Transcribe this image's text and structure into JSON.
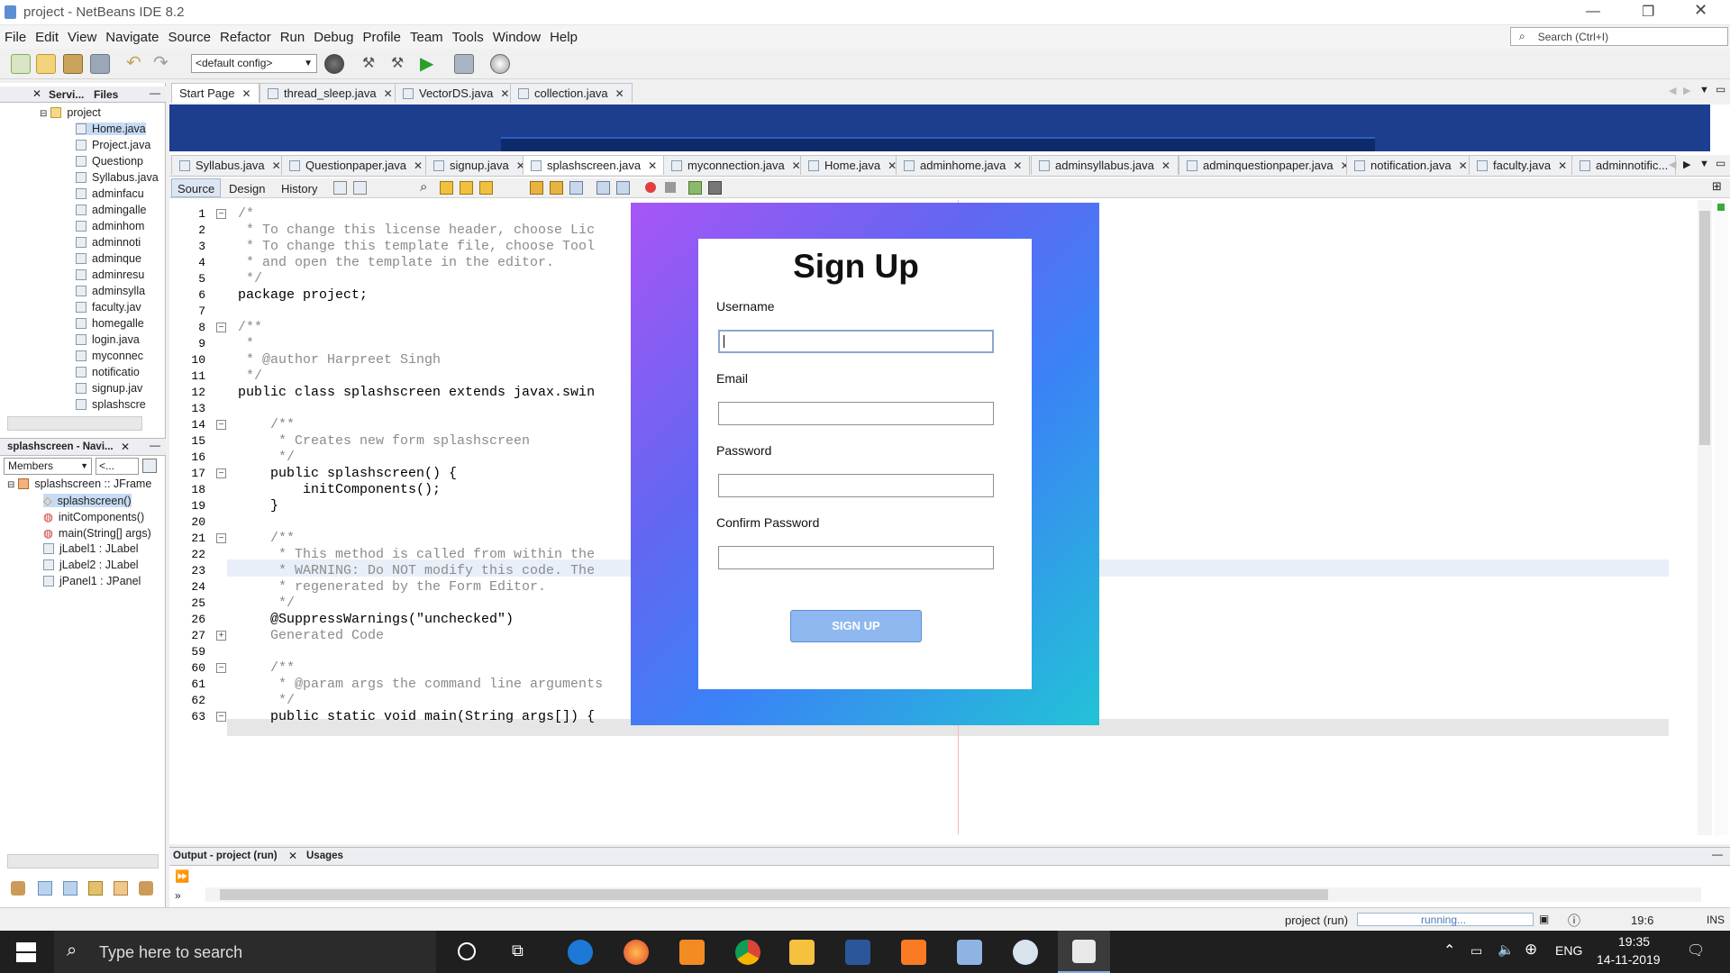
{
  "window": {
    "title": "project - NetBeans IDE 8.2"
  },
  "menu": [
    "File",
    "Edit",
    "View",
    "Navigate",
    "Source",
    "Refactor",
    "Run",
    "Debug",
    "Profile",
    "Team",
    "Tools",
    "Window",
    "Help"
  ],
  "search": {
    "placeholder": "Search (Ctrl+I)"
  },
  "toolbar": {
    "config": "<default config>"
  },
  "projects_panel": {
    "tabs": [
      "Servi...",
      "Files"
    ],
    "root": "project",
    "files": [
      "Home.java",
      "Project.java",
      "Questionp",
      "Syllabus.java",
      "adminfacu",
      "admingalle",
      "adminhom",
      "adminnoti",
      "adminque",
      "adminresu",
      "adminsylla",
      "faculty.jav",
      "homegalle",
      "login.java",
      "myconnec",
      "notificatio",
      "signup.jav",
      "splashscre"
    ]
  },
  "navigator": {
    "title": "splashscreen - Navi...",
    "filter": "Members",
    "filter2": "<...",
    "root": "splashscreen :: JFrame",
    "members": [
      "splashscreen()",
      "initComponents()",
      "main(String[] args)",
      "jLabel1 : JLabel",
      "jLabel2 : JLabel",
      "jPanel1 : JPanel"
    ]
  },
  "top_tabs": [
    "Start Page",
    "thread_sleep.java",
    "VectorDS.java",
    "collection.java"
  ],
  "editor_tabs": [
    "Syllabus.java",
    "Questionpaper.java",
    "signup.java",
    "splashscreen.java",
    "myconnection.java",
    "Home.java",
    "adminhome.java",
    "adminsyllabus.java",
    "adminquestionpaper.java",
    "notification.java",
    "faculty.java",
    "adminnotific..."
  ],
  "editor_views": [
    "Source",
    "Design",
    "History"
  ],
  "code": [
    {
      "n": "1",
      "t": "/*",
      "c": "cm"
    },
    {
      "n": "2",
      "t": " * To change this license header, choose Lic",
      "c": "cm"
    },
    {
      "n": "3",
      "t": " * To change this template file, choose Tool",
      "c": "cm"
    },
    {
      "n": "4",
      "t": " * and open the template in the editor.",
      "c": "cm"
    },
    {
      "n": "5",
      "t": " */",
      "c": "cm"
    },
    {
      "n": "6",
      "t": "package project;",
      "c": ""
    },
    {
      "n": "7",
      "t": "",
      "c": ""
    },
    {
      "n": "8",
      "t": "/**",
      "c": "cm"
    },
    {
      "n": "9",
      "t": " *",
      "c": "cm"
    },
    {
      "n": "10",
      "t": " * @author Harpreet Singh",
      "c": "cm"
    },
    {
      "n": "11",
      "t": " */",
      "c": "cm"
    },
    {
      "n": "12",
      "t": "public class splashscreen extends javax.swin",
      "c": ""
    },
    {
      "n": "13",
      "t": "",
      "c": ""
    },
    {
      "n": "14",
      "t": "    /**",
      "c": "cm"
    },
    {
      "n": "15",
      "t": "     * Creates new form splashscreen",
      "c": "cm"
    },
    {
      "n": "16",
      "t": "     */",
      "c": "cm"
    },
    {
      "n": "17",
      "t": "    public splashscreen() {",
      "c": ""
    },
    {
      "n": "18",
      "t": "        initComponents();",
      "c": ""
    },
    {
      "n": "19",
      "t": "    }",
      "c": ""
    },
    {
      "n": "20",
      "t": "",
      "c": ""
    },
    {
      "n": "21",
      "t": "    /**",
      "c": "cm"
    },
    {
      "n": "22",
      "t": "     * This method is called from within the",
      "c": "cm"
    },
    {
      "n": "23",
      "t": "     * WARNING: Do NOT modify this code. The",
      "c": "cm"
    },
    {
      "n": "24",
      "t": "     * regenerated by the Form Editor.",
      "c": "cm"
    },
    {
      "n": "25",
      "t": "     */",
      "c": "cm"
    },
    {
      "n": "26",
      "t": "    @SuppressWarnings(\"unchecked\")",
      "c": ""
    },
    {
      "n": "27",
      "t": "    Generated Code",
      "c": "cm"
    },
    {
      "n": "59",
      "t": "",
      "c": ""
    },
    {
      "n": "60",
      "t": "    /**",
      "c": "cm"
    },
    {
      "n": "61",
      "t": "     * @param args the command line arguments",
      "c": "cm"
    },
    {
      "n": "62",
      "t": "     */",
      "c": "cm"
    },
    {
      "n": "63",
      "t": "    public static void main(String args[]) {",
      "c": ""
    }
  ],
  "signup_form": {
    "title": "Sign Up",
    "username_label": "Username",
    "email_label": "Email",
    "password_label": "Password",
    "confirm_label": "Confirm Password",
    "button": "SIGN UP"
  },
  "output_panel": {
    "tab1": "Output - project (run)",
    "tab2": "Usages"
  },
  "status": {
    "project": "project (run)",
    "progress": "running...",
    "position": "19:6",
    "mode": "INS"
  },
  "taskbar": {
    "search_placeholder": "Type here to search",
    "lang": "ENG",
    "time": "19:35",
    "date": "14-11-2019"
  }
}
